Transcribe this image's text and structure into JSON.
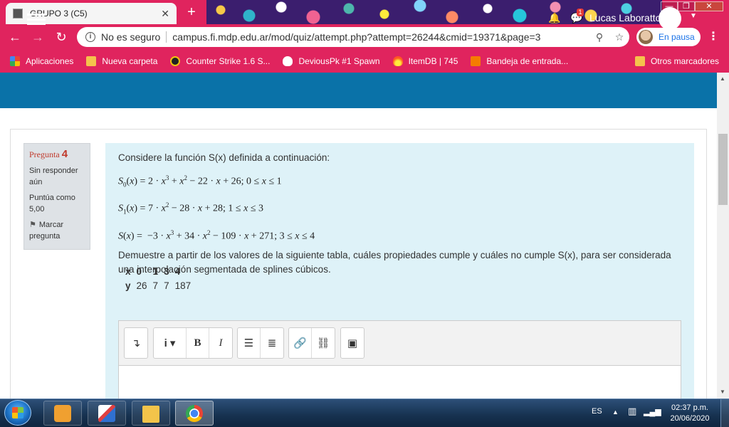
{
  "browser": {
    "tab_title": "GRUPO 3 (C5)",
    "tab_close": "✕",
    "new_tab": "+",
    "insecure_label": "No es seguro",
    "url": "campus.fi.mdp.edu.ar/mod/quiz/attempt.php?attempt=26244&cmid=19371&page=3",
    "profile_status": "En pausa",
    "window_controls": [
      "—",
      "❐",
      "✕"
    ]
  },
  "bookmarks": [
    {
      "label": "Aplicaciones",
      "icon": "apps-icon"
    },
    {
      "label": "Nueva carpeta",
      "icon": "folder-icon"
    },
    {
      "label": "Counter Strike 1.6 S...",
      "icon": "cs-icon"
    },
    {
      "label": "DeviousPk #1 Spawn",
      "icon": "shield-icon"
    },
    {
      "label": "ItemDB | 745",
      "icon": "fire-icon"
    },
    {
      "label": "Bandeja de entrada...",
      "icon": "foro-icon"
    }
  ],
  "bookmarks_other": "Otros marcadores",
  "moodle": {
    "user_name": "Lucas Laboratto",
    "message_count": "1"
  },
  "question": {
    "label": "Pregunta",
    "number": "4",
    "status": "Sin responder aún",
    "grade": "Puntúa como 5,00",
    "flag": "Marcar pregunta",
    "intro": "Considere la función S(x) definida a continuación:",
    "demand": "Demuestre a partir de los valores de la siguiente tabla, cuáles propiedades cumple y cuáles no cumple S(x), para ser considerada una interpolación segmentada de splines cúbicos.",
    "table": {
      "x_label": "x",
      "y_label": "y",
      "x": [
        "0",
        "1",
        "3",
        "4"
      ],
      "y": [
        "26",
        "7",
        "7",
        "187"
      ]
    }
  },
  "taskbar": {
    "language": "ES",
    "time": "02:37 p.m.",
    "date": "20/06/2020"
  }
}
